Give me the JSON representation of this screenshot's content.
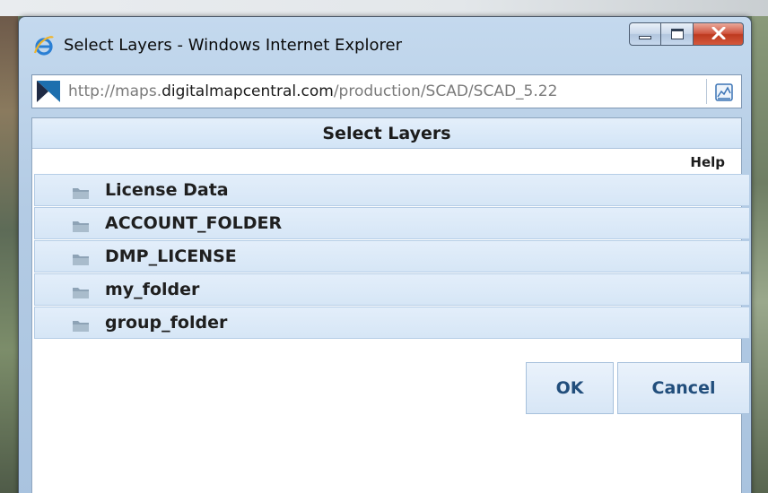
{
  "window": {
    "title": "Select Layers - Windows Internet Explorer",
    "url_host_prefix": "http://maps.",
    "url_host": "digitalmapcentral.com",
    "url_path": "/production/SCAD/SCAD_5.22"
  },
  "icons": {
    "browser": "internet-explorer-icon",
    "site": "site-favicon-icon",
    "compat": "compatibility-view-icon",
    "folder": "folder-icon",
    "minimize": "minimize-icon",
    "maximize": "maximize-icon",
    "close": "close-icon"
  },
  "panel": {
    "title": "Select Layers",
    "help_label": "Help"
  },
  "layers": [
    {
      "label": "License Data"
    },
    {
      "label": "ACCOUNT_FOLDER"
    },
    {
      "label": "DMP_LICENSE"
    },
    {
      "label": "my_folder"
    },
    {
      "label": "group_folder"
    }
  ],
  "buttons": {
    "ok_label": "OK",
    "cancel_label": "Cancel"
  },
  "colors": {
    "accent_text": "#214e7c",
    "row_background": "#d6e6f6",
    "close_button": "#c8472c"
  }
}
